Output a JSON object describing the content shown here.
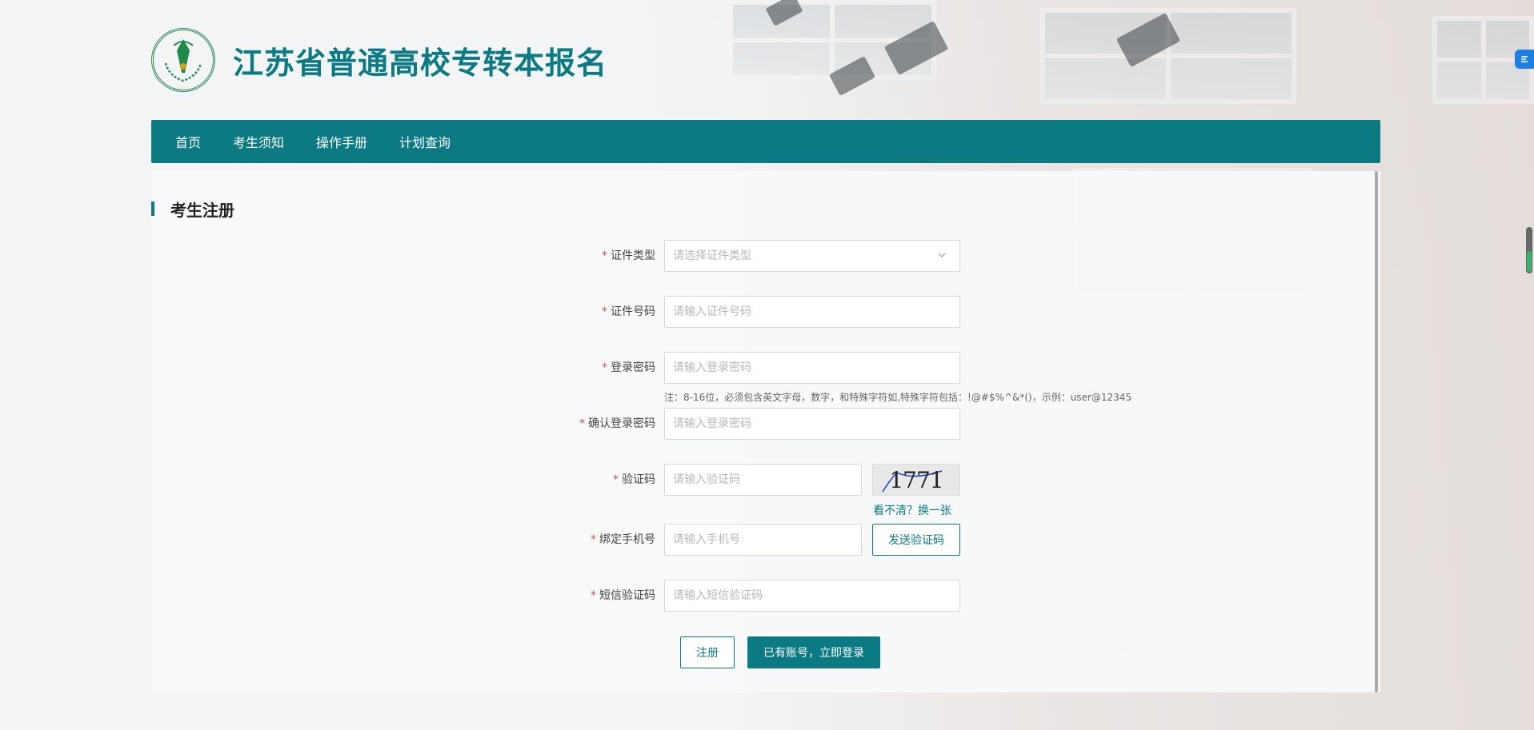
{
  "site": {
    "title": "江苏省普通高校专转本报名"
  },
  "nav": {
    "items": [
      {
        "label": "首页"
      },
      {
        "label": "考生须知"
      },
      {
        "label": "操作手册"
      },
      {
        "label": "计划查询"
      }
    ]
  },
  "form": {
    "section_title": "考生注册",
    "required_mark": "*",
    "id_type": {
      "label": "证件类型",
      "placeholder": "请选择证件类型",
      "value": ""
    },
    "id_number": {
      "label": "证件号码",
      "placeholder": "请输入证件号码",
      "value": ""
    },
    "password": {
      "label": "登录密码",
      "placeholder": "请输入登录密码",
      "value": "",
      "hint": "注：8-16位，必须包含英文字母，数字，和特殊字符如,特殊字符包括：!@#$%^&*()，示例：user@12345"
    },
    "confirm_password": {
      "label": "确认登录密码",
      "placeholder": "请输入登录密码",
      "value": ""
    },
    "captcha": {
      "label": "验证码",
      "placeholder": "请输入验证码",
      "value": "",
      "image_text": "1771",
      "refresh_link": "看不清？换一张"
    },
    "phone": {
      "label": "绑定手机号",
      "placeholder": "请输入手机号",
      "value": "",
      "send_button": "发送验证码"
    },
    "sms_code": {
      "label": "短信验证码",
      "placeholder": "请输入短信验证码",
      "value": ""
    },
    "register_button": "注册",
    "login_button": "已有账号，立即登录"
  },
  "colors": {
    "primary": "#0b7a83",
    "required": "#e74c3c",
    "page_background": "#f0f2f5"
  }
}
